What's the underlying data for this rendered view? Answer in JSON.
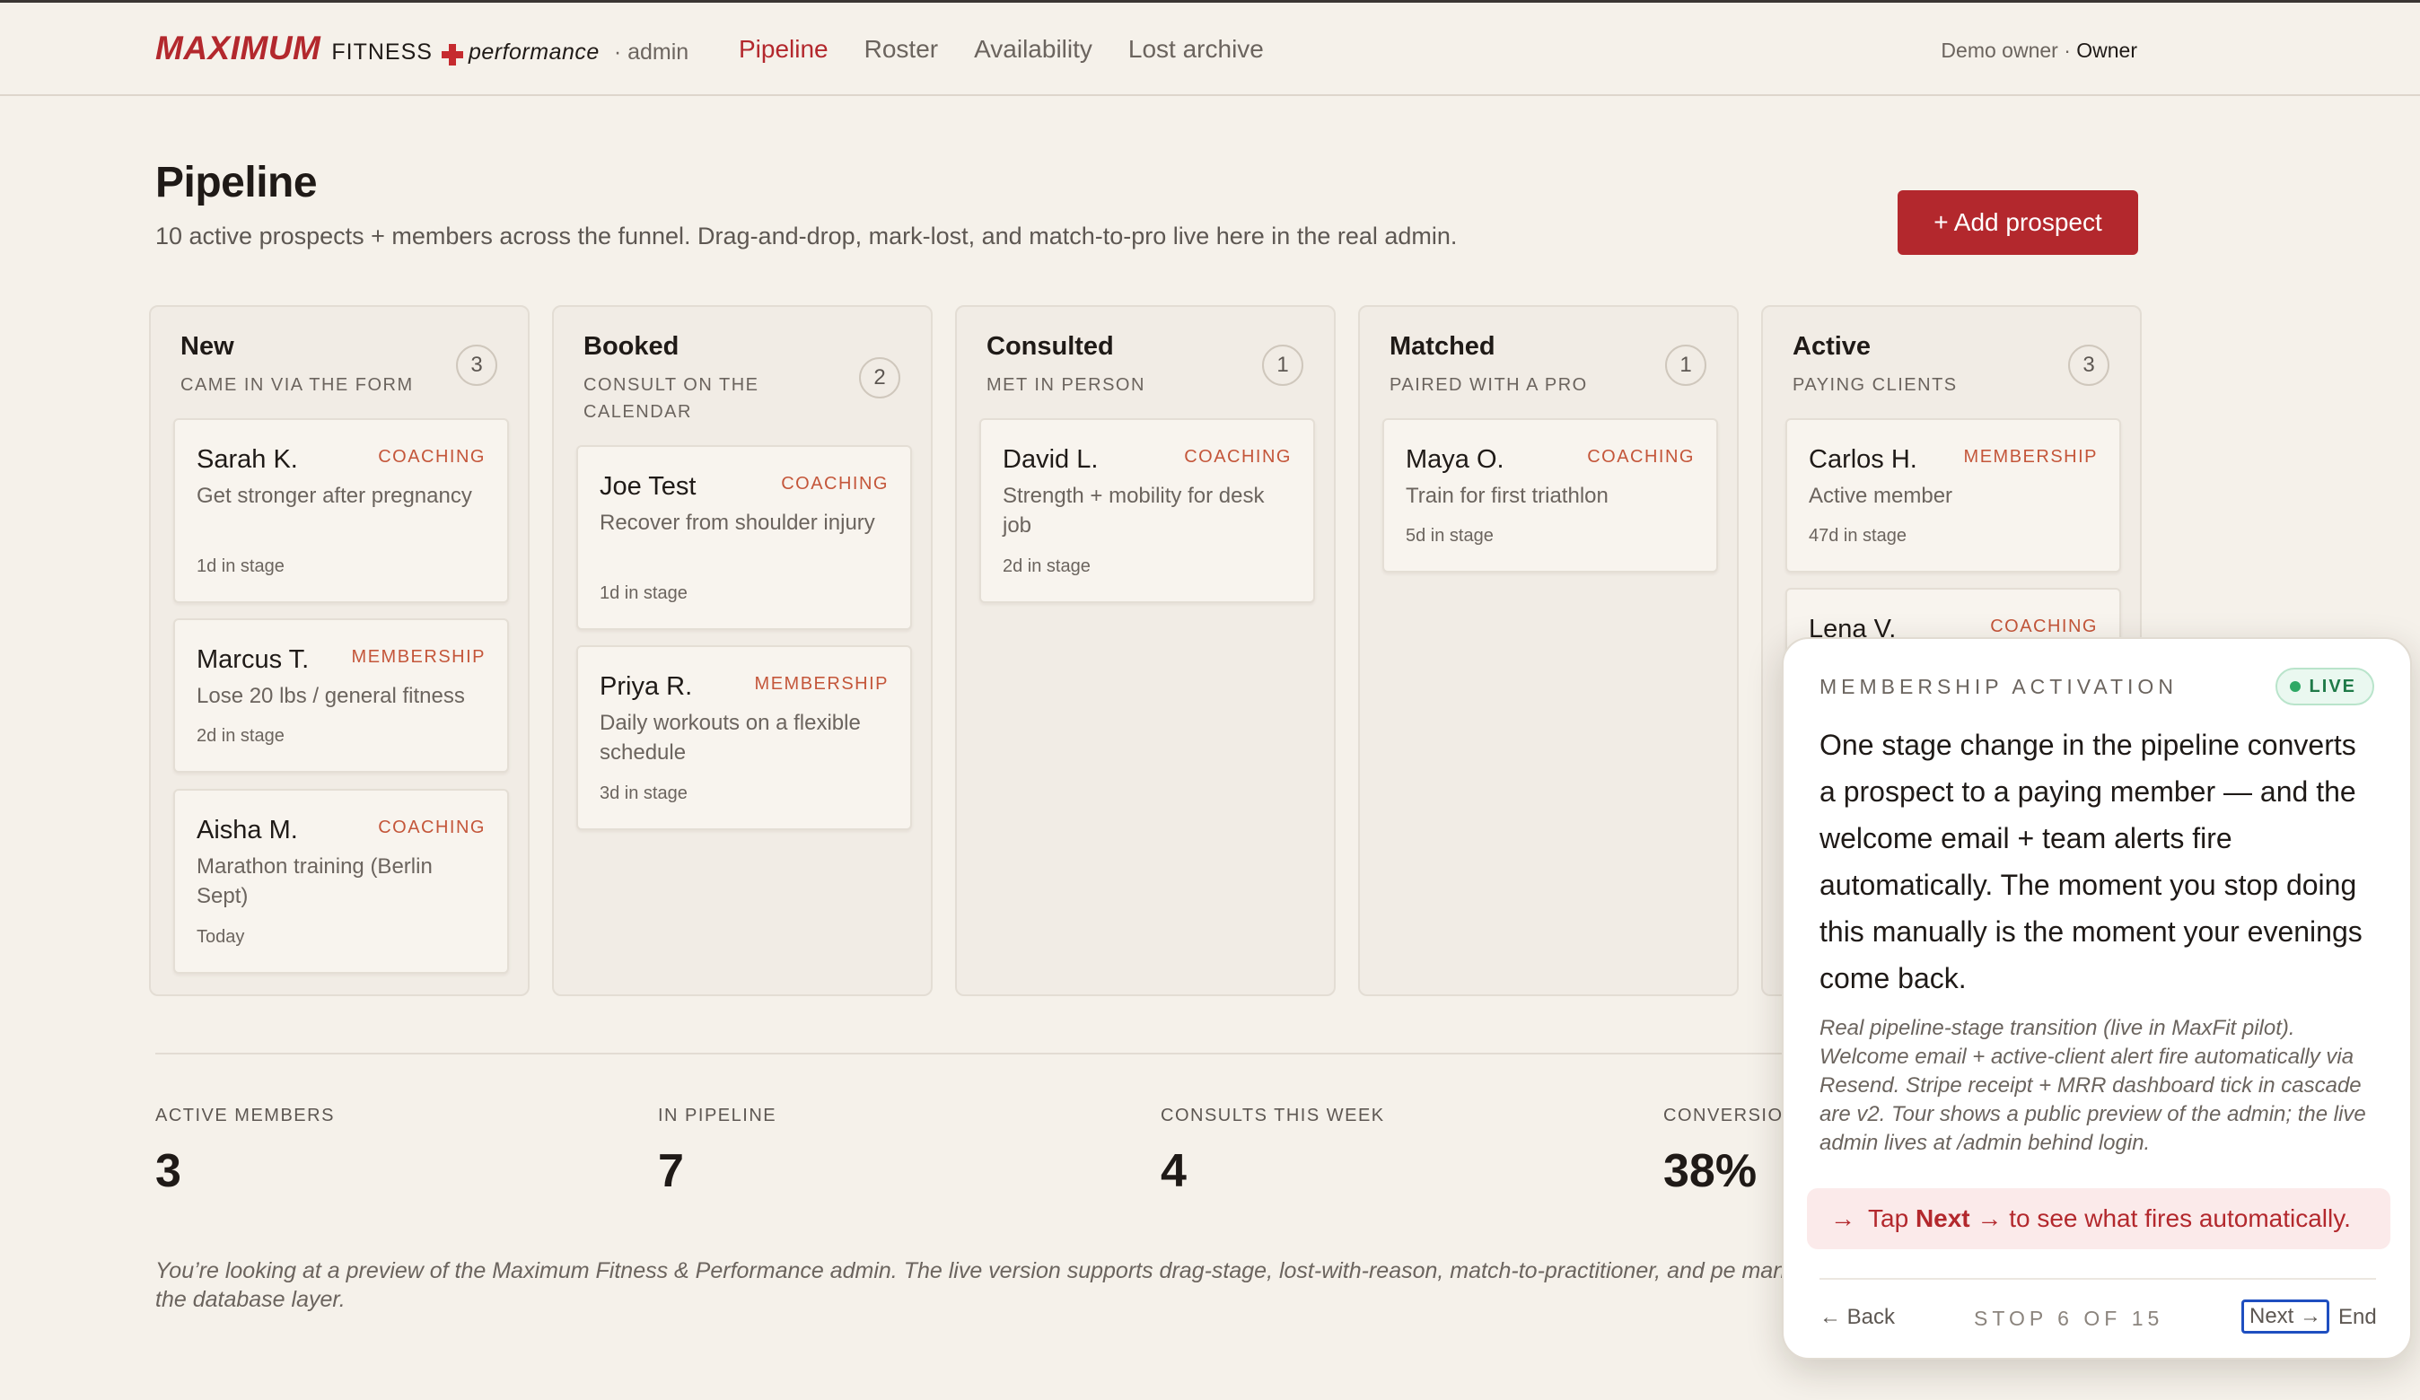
{
  "header": {
    "brand_main": "MAXIMUM",
    "brand_fitness": "FITNESS",
    "brand_perf": "performance",
    "brand_admin": "· admin",
    "nav": [
      "Pipeline",
      "Roster",
      "Availability",
      "Lost archive"
    ],
    "active_nav": "Pipeline",
    "user_name": "Demo owner · ",
    "user_role": "Owner"
  },
  "page": {
    "title": "Pipeline",
    "subtitle": "10 active prospects + members across the funnel. Drag-and-drop, mark-lost, and match-to-pro live here in the real admin.",
    "add_button": "+ Add prospect"
  },
  "columns": [
    {
      "title": "New",
      "subtitle": "CAME IN VIA THE FORM",
      "count": "3",
      "cards": [
        {
          "name": "Sarah K.",
          "tag": "COACHING",
          "goal": "Get stronger after pregnancy",
          "age": "1d in stage"
        },
        {
          "name": "Marcus T.",
          "tag": "MEMBERSHIP",
          "goal": "Lose 20 lbs / general fitness",
          "age": "2d in stage"
        },
        {
          "name": "Aisha M.",
          "tag": "COACHING",
          "goal": "Marathon training (Berlin Sept)",
          "age": "Today"
        }
      ]
    },
    {
      "title": "Booked",
      "subtitle": "CONSULT ON THE CALENDAR",
      "count": "2",
      "cards": [
        {
          "name": "Joe Test",
          "tag": "COACHING",
          "goal": "Recover from shoulder injury",
          "age": "1d in stage"
        },
        {
          "name": "Priya R.",
          "tag": "MEMBERSHIP",
          "goal": "Daily workouts on a flexible schedule",
          "age": "3d in stage"
        }
      ]
    },
    {
      "title": "Consulted",
      "subtitle": "MET IN PERSON",
      "count": "1",
      "cards": [
        {
          "name": "David L.",
          "tag": "COACHING",
          "goal": "Strength + mobility for desk job",
          "age": "2d in stage"
        }
      ]
    },
    {
      "title": "Matched",
      "subtitle": "PAIRED WITH A PRO",
      "count": "1",
      "cards": [
        {
          "name": "Maya O.",
          "tag": "COACHING",
          "goal": "Train for first triathlon",
          "age": "5d in stage"
        }
      ]
    },
    {
      "title": "Active",
      "subtitle": "PAYING CLIENTS",
      "count": "3",
      "cards": [
        {
          "name": "Carlos H.",
          "tag": "MEMBERSHIP",
          "goal": "Active member",
          "age": "47d in stage"
        },
        {
          "name": "Lena V.",
          "tag": "COACHING"
        }
      ]
    }
  ],
  "stats": [
    {
      "label": "ACTIVE MEMBERS",
      "value": "3"
    },
    {
      "label": "IN PIPELINE",
      "value": "7"
    },
    {
      "label": "CONSULTS THIS WEEK",
      "value": "4"
    },
    {
      "label": "CONVERSIO",
      "value": "38%"
    }
  ],
  "footnote": "You’re looking at a preview of the Maximum Fitness & Performance admin. The live version supports drag-stage, lost-with-reason, match-to-practitioner, and pe management / practitioner) enforced at the database layer.",
  "tour": {
    "eyebrow": "MEMBERSHIP ACTIVATION",
    "badge": "LIVE",
    "body": "One stage change in the pipeline converts a prospect to a paying member — and the welcome email + team alerts fire automatically. The moment you stop doing this manually is the moment your evenings come back.",
    "note": "Real pipeline-stage transition (live in MaxFit pilot). Welcome email + active-client alert fire automatically via Resend. Stripe receipt + MRR dashboard tick in cascade are v2. Tour shows a public preview of the admin; the live admin lives at /admin behind login.",
    "cta_arrow": "→",
    "cta_pre": "Tap",
    "cta_bold": "Next →",
    "cta_post": "to see what fires automatically.",
    "back": "← Back",
    "step": "STOP 6 OF 15",
    "next": "Next →",
    "end": "End"
  },
  "colors": {
    "accent": "#b3282d",
    "tag": "#c4563a",
    "background": "#f5f1ea",
    "live": "#2ea865"
  }
}
